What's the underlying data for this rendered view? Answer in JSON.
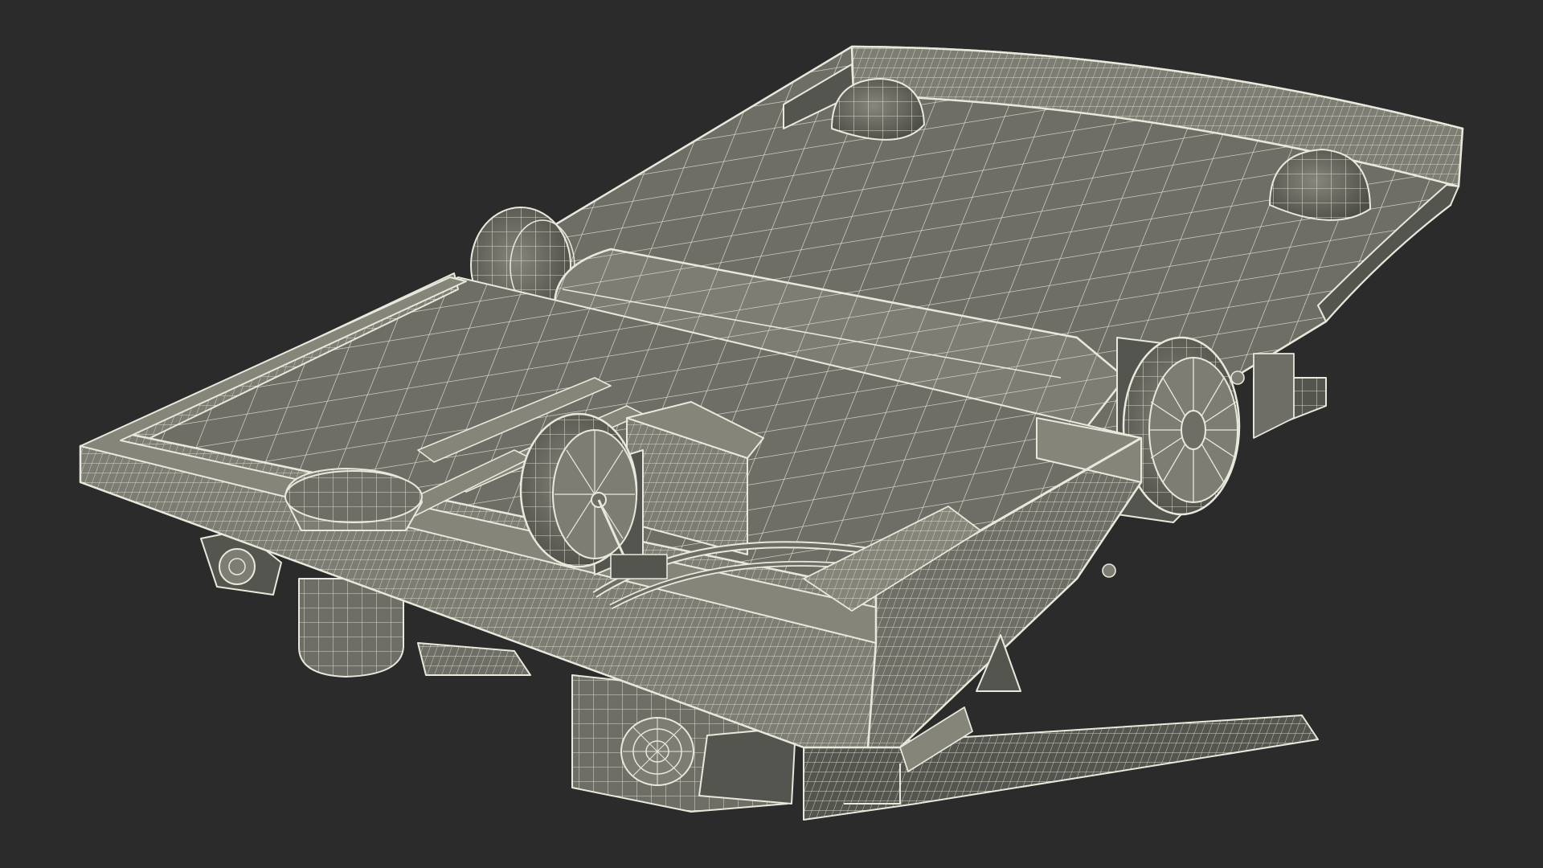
{
  "scene": {
    "subject": "wireframe-chassis-render",
    "colors": {
      "background": "#2b2b2b",
      "surface": "#6e6e66",
      "surface_light": "#7d7d74",
      "surface_dark": "#55554f",
      "wire": "#e8e8dc"
    }
  }
}
